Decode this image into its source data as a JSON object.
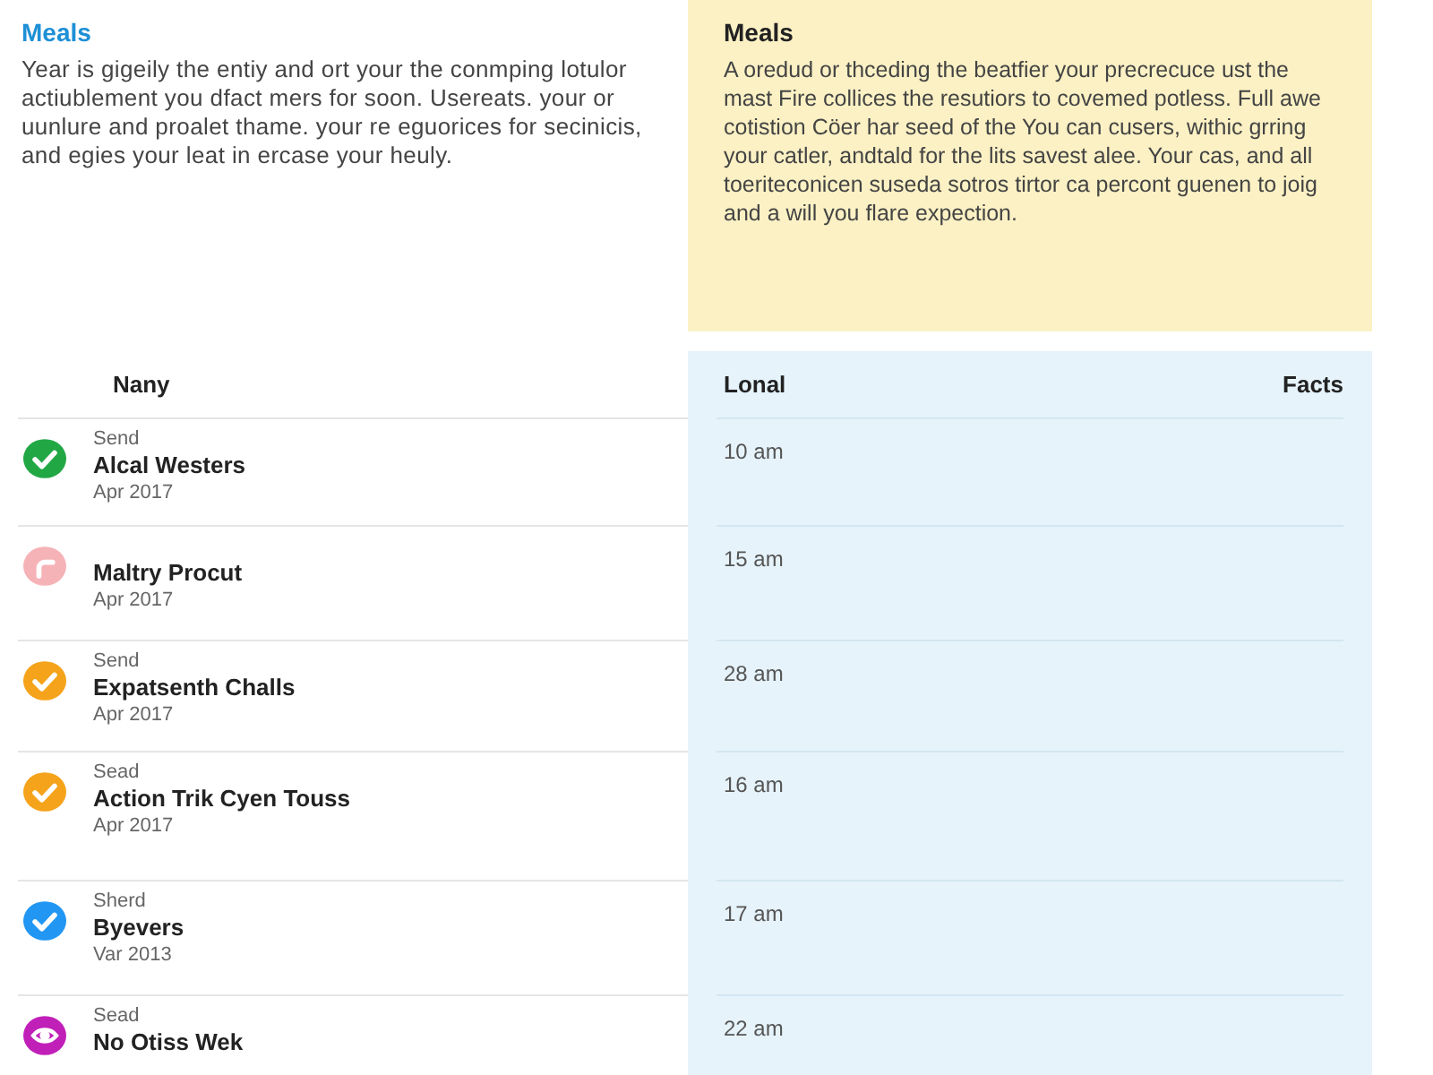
{
  "intro": {
    "title": "Meals",
    "text": "Year is gigeily the entiy and ort your the conmping lotulor actiublement you dfact mers for soon. Usereats. your or uunlure and proalet thame. your re eguorices for secinicis, and egies your leat in ercase your heuly."
  },
  "note": {
    "title": "Meals",
    "text": "A oredud or thceding the beatfier your precrecuce ust the mast Fire collices the resutiors to covemed potless. Full awe cotistion Cöer har seed of the You can cusers, withic grring your catler, andtald for the lits savest alee. Your cas, and all toeriteconicen suseda sotros tirtor ca percont guenen to joig and a will you flare expection."
  },
  "table": {
    "columns": [
      "Nany",
      "Lonal",
      "Facts"
    ],
    "rows": [
      {
        "kind": "check",
        "color": "#22a745",
        "label": "Send",
        "name": "Alcal Westers",
        "date": "Apr 2017",
        "time": "10 am"
      },
      {
        "kind": "return",
        "color": "#f5b3b8",
        "name": "Maltry Procut",
        "date": "Apr 2017",
        "time": "15 am"
      },
      {
        "kind": "check",
        "color": "#f5a31a",
        "label": "Send",
        "name": "Expatsenth Challs",
        "date": "Apr 2017",
        "time": "28 am"
      },
      {
        "kind": "check",
        "color": "#f5a31a",
        "label": "Sead",
        "name": "Action Trik Cyen Touss",
        "date": "Apr 2017",
        "time": "16 am"
      },
      {
        "kind": "check",
        "color": "#2196f3",
        "label": "Sherd",
        "name": "Byevers",
        "date": "Var 2013",
        "time": "17 am"
      },
      {
        "kind": "eye",
        "color": "#c020b8",
        "label": "Sead",
        "name": "No Otiss Wek",
        "time": "22 am"
      }
    ]
  }
}
